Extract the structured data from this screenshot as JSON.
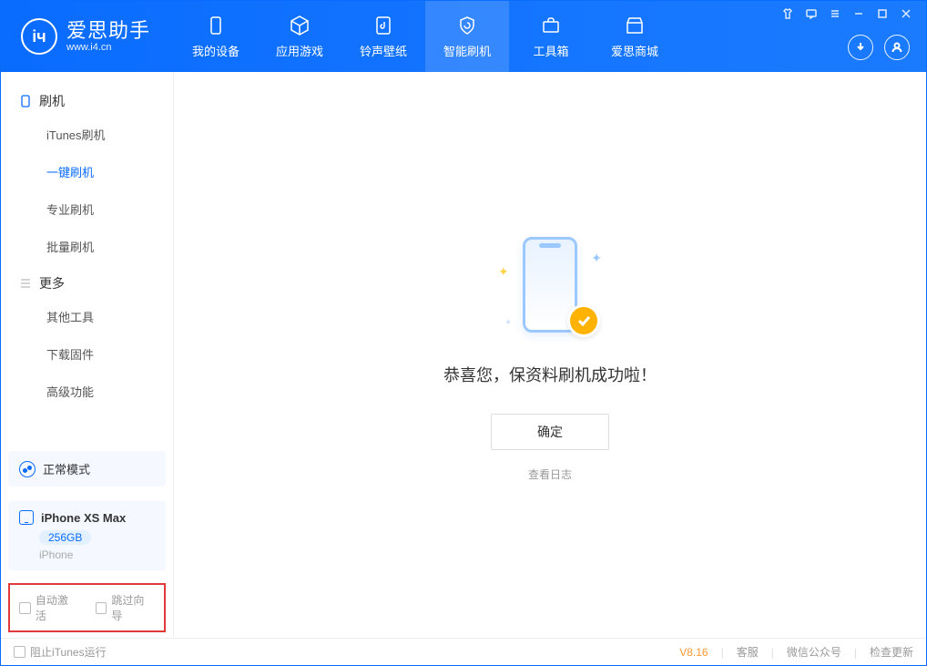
{
  "app": {
    "name": "爱思助手",
    "url": "www.i4.cn"
  },
  "nav": {
    "items": [
      {
        "label": "我的设备"
      },
      {
        "label": "应用游戏"
      },
      {
        "label": "铃声壁纸"
      },
      {
        "label": "智能刷机"
      },
      {
        "label": "工具箱"
      },
      {
        "label": "爱思商城"
      }
    ]
  },
  "sidebar": {
    "group_flash": "刷机",
    "items_flash": [
      {
        "label": "iTunes刷机"
      },
      {
        "label": "一键刷机"
      },
      {
        "label": "专业刷机"
      },
      {
        "label": "批量刷机"
      }
    ],
    "group_more": "更多",
    "items_more": [
      {
        "label": "其他工具"
      },
      {
        "label": "下载固件"
      },
      {
        "label": "高级功能"
      }
    ]
  },
  "device": {
    "mode": "正常模式",
    "name": "iPhone XS Max",
    "capacity": "256GB",
    "type": "iPhone"
  },
  "options": {
    "auto_activate": "自动激活",
    "skip_guide": "跳过向导"
  },
  "main": {
    "success": "恭喜您，保资料刷机成功啦！",
    "ok": "确定",
    "view_log": "查看日志"
  },
  "footer": {
    "block_itunes": "阻止iTunes运行",
    "version": "V8.16",
    "links": [
      "客服",
      "微信公众号",
      "检查更新"
    ]
  }
}
